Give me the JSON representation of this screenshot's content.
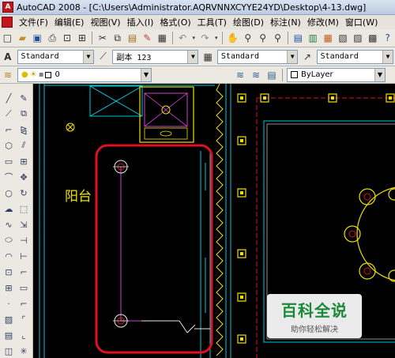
{
  "window": {
    "title": "AutoCAD 2008 - [C:\\Users\\Administrator.AQRVNNXCYYE24YD\\Desktop\\4-13.dwg]",
    "app_icon_label": "A"
  },
  "menu": {
    "items": [
      "文件(F)",
      "编辑(E)",
      "视图(V)",
      "插入(I)",
      "格式(O)",
      "工具(T)",
      "绘图(D)",
      "标注(N)",
      "修改(M)",
      "窗口(W)"
    ]
  },
  "styles_toolbar": {
    "text_style": "Standard",
    "dim_style": "副本 123",
    "table_style": "Standard",
    "multileader_style": "Standard"
  },
  "layers_toolbar": {
    "layer_name": "0",
    "color": "ByLayer"
  },
  "drawing": {
    "room_label": "阳台"
  },
  "watermark": {
    "title": "百科全说",
    "subtitle": "助你轻松解决"
  },
  "colors": {
    "canvas_bg": "#000000",
    "cyan": "#00c8d8",
    "yellow": "#f0e000",
    "magenta": "#d040d0",
    "highlight_red": "#e01020",
    "white": "#e8e8e8"
  }
}
